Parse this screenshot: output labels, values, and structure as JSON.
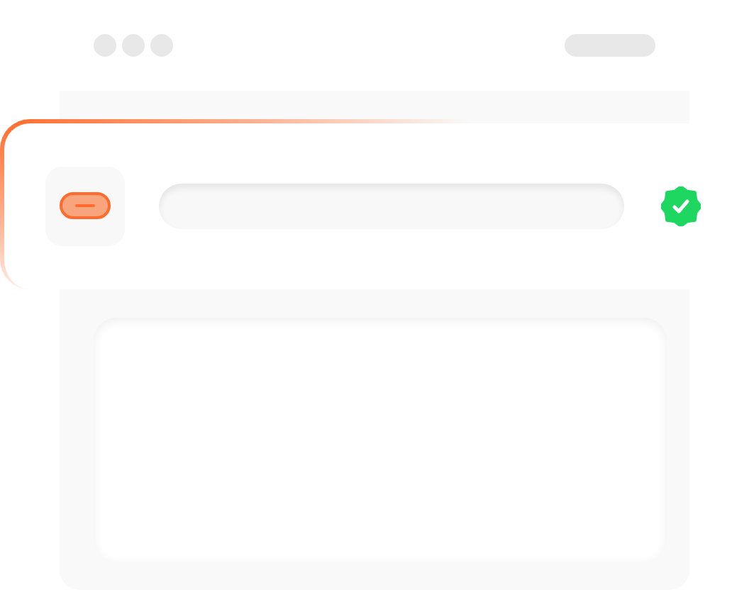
{
  "link_field": {
    "verified": true
  }
}
